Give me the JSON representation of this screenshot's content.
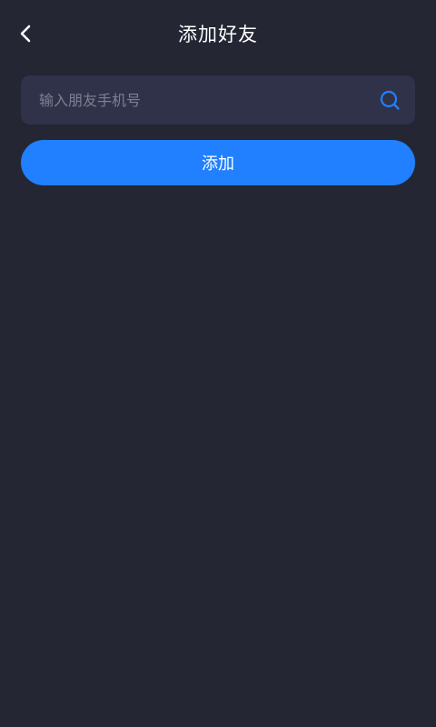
{
  "header": {
    "title": "添加好友",
    "back_icon": "chevron-left-icon"
  },
  "search": {
    "value": "",
    "placeholder": "输入朋友手机号",
    "icon": "search-icon"
  },
  "actions": {
    "add_label": "添加"
  },
  "colors": {
    "background": "#242634",
    "input_background": "#30324a",
    "accent": "#2180ff",
    "placeholder": "#7d8091",
    "text": "#ffffff"
  }
}
